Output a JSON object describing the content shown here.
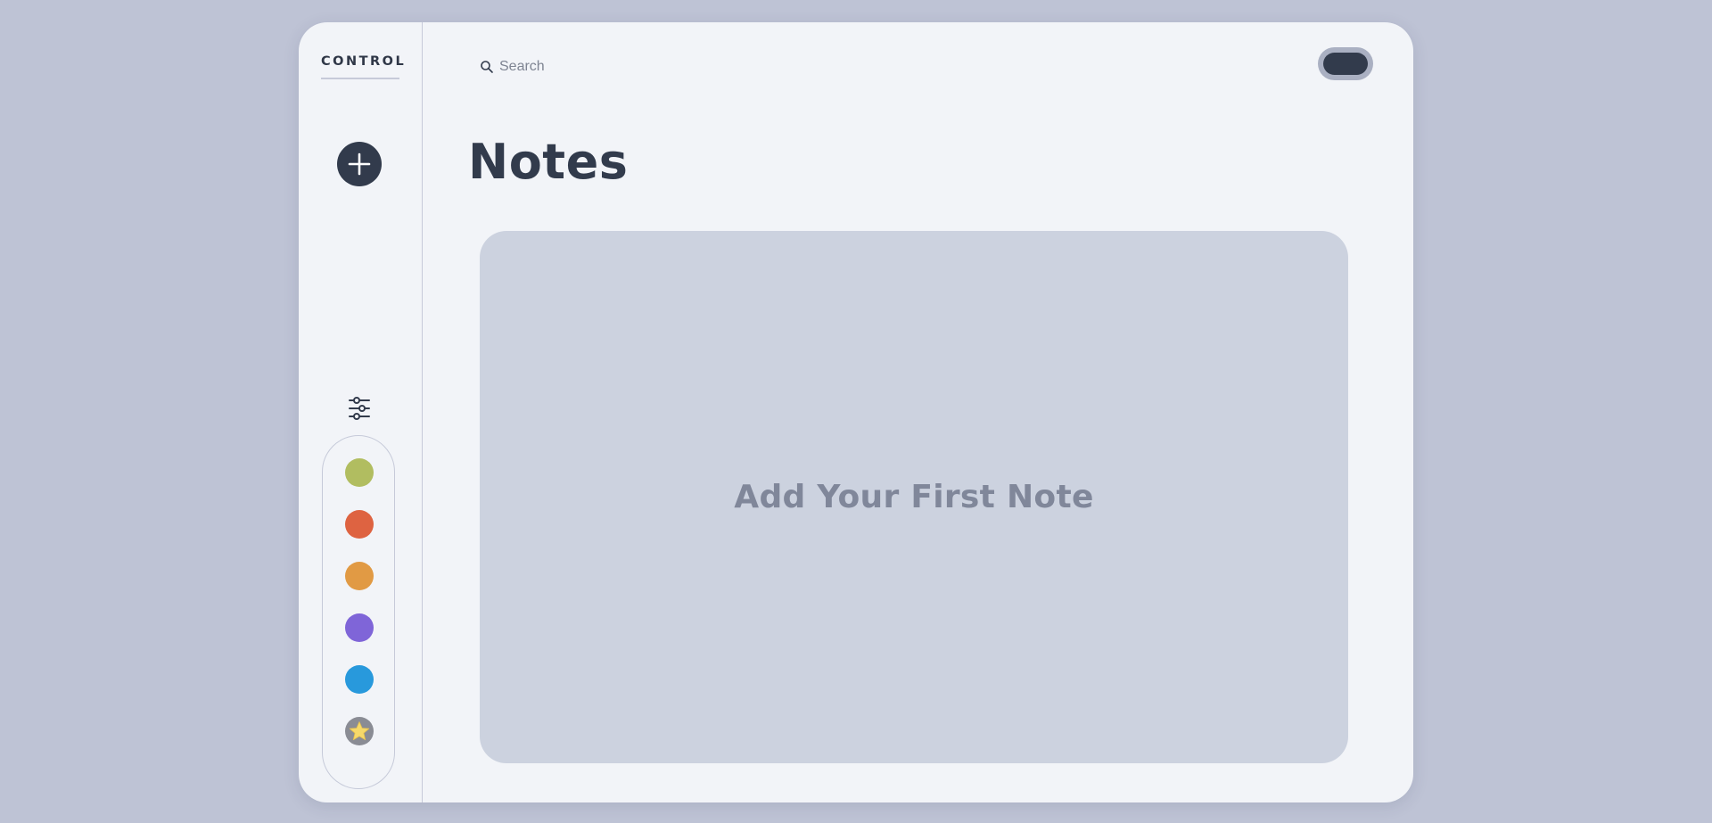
{
  "sidebar": {
    "brand": "CONTROL",
    "colors": [
      {
        "name": "green",
        "hex": "#b1bd60"
      },
      {
        "name": "red",
        "hex": "#de6341"
      },
      {
        "name": "orange",
        "hex": "#e19a44"
      },
      {
        "name": "purple",
        "hex": "#7f65d8"
      },
      {
        "name": "blue",
        "hex": "#2899dc"
      }
    ],
    "favorites_icon": "star-icon"
  },
  "header": {
    "search_placeholder": "Search",
    "theme_toggle_icon": "moon-icon"
  },
  "main": {
    "title": "Notes",
    "empty_message": "Add Your First Note"
  },
  "theme": {
    "background": "#bec3d5",
    "panel": "#f2f4f8",
    "accent": "#323b4c",
    "card": "#ccd2df"
  }
}
